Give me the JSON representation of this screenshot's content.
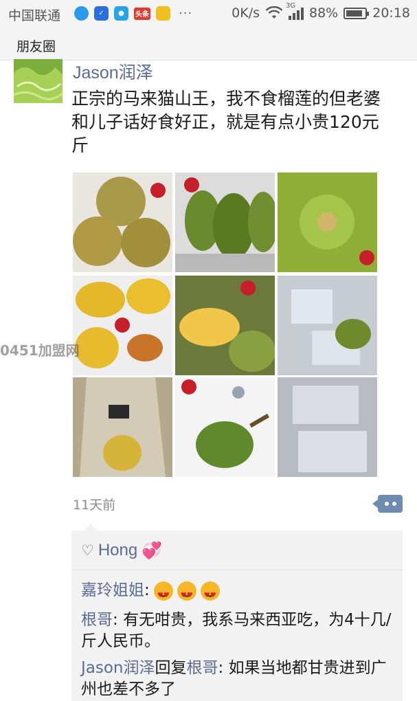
{
  "status_bar": {
    "carrier": "中国联通",
    "network_speed": "0K/s",
    "network_type": "3G",
    "battery": "88%",
    "battery_level": 0.88,
    "time": "20:18",
    "app_icons": [
      "qq-browser-icon",
      "shield-icon",
      "chat-icon",
      "toutiao-icon",
      "pig-icon"
    ],
    "toutiao_text": "头条",
    "more": "···"
  },
  "nav": {
    "title": "朋友圈"
  },
  "post": {
    "author": "Jason润泽",
    "text": "正宗的马来猫山王，我不食榴莲的但老婆和儿子话好食好正，就是有点小贵120元斤",
    "timestamp": "11天前",
    "photos": [
      "durian-whole-on-newspaper",
      "durians-on-shelf",
      "durian-closeup-spikes",
      "durian-flesh-opened",
      "durian-opened-on-table",
      "packed-durian-bags",
      "durian-flesh-in-bag",
      "durian-with-figurine",
      "foil-wrapped-packages"
    ]
  },
  "likes": {
    "names": "Hong",
    "emoji": "💞"
  },
  "comments": [
    {
      "author": "嘉玲姐姐",
      "sep": ": ",
      "text": ""
    },
    {
      "author": "根哥",
      "sep": ": ",
      "text": "有无咁贵，我系马来西亚吃，为4十几/斤人民币。"
    },
    {
      "author": "Jason润泽",
      "reply_word": "回复",
      "reply_to": "根哥",
      "sep": ": ",
      "text": "如果当地都甘贵进到广州也差不多了"
    }
  ],
  "watermark": "0451加盟网",
  "colors": {
    "link": "#5a6b96",
    "more_button": "#6f8bb0",
    "comment_bg": "#f2f2f2"
  }
}
